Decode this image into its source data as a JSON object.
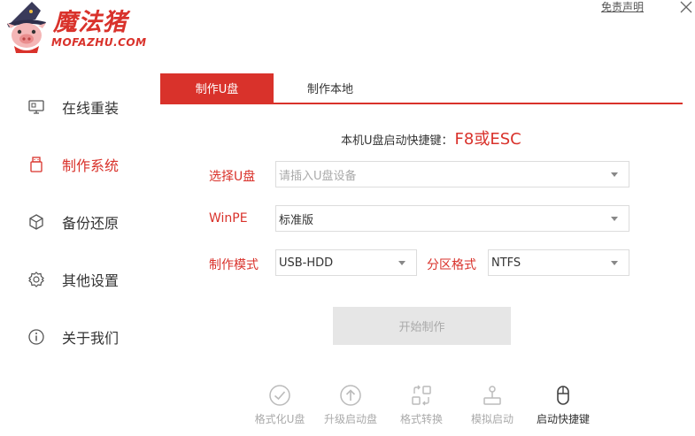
{
  "header": {
    "disclaimer": "免责声明",
    "logo_name": "魔法猪",
    "logo_sub": "MOFAZHU.COM"
  },
  "sidebar": {
    "items": [
      {
        "label": "在线重装",
        "icon": "monitor-icon",
        "active": false
      },
      {
        "label": "制作系统",
        "icon": "usb-drive-icon",
        "active": true
      },
      {
        "label": "备份还原",
        "icon": "cube-icon",
        "active": false
      },
      {
        "label": "其他设置",
        "icon": "gear-icon",
        "active": false
      },
      {
        "label": "关于我们",
        "icon": "info-icon",
        "active": false
      }
    ]
  },
  "tabs": [
    {
      "label": "制作U盘",
      "active": true
    },
    {
      "label": "制作本地",
      "active": false
    }
  ],
  "hotkey": {
    "label": "本机U盘启动快捷键：",
    "value": "F8或ESC"
  },
  "form": {
    "usb_label": "选择U盘",
    "usb_placeholder": "请插入U盘设备",
    "winpe_label": "WinPE",
    "winpe_value": "标准版",
    "mode_label": "制作模式",
    "mode_value": "USB-HDD",
    "partition_label": "分区格式",
    "partition_value": "NTFS"
  },
  "start_button": "开始制作",
  "tools": [
    {
      "label": "格式化U盘",
      "icon": "check-circle-icon",
      "enabled": false
    },
    {
      "label": "升级启动盘",
      "icon": "upload-circle-icon",
      "enabled": false
    },
    {
      "label": "格式转换",
      "icon": "convert-icon",
      "enabled": false
    },
    {
      "label": "模拟启动",
      "icon": "joystick-icon",
      "enabled": false
    },
    {
      "label": "启动快捷键",
      "icon": "mouse-icon",
      "enabled": true
    }
  ],
  "colors": {
    "accent": "#d9322b",
    "disabled": "#aaaaaa"
  }
}
